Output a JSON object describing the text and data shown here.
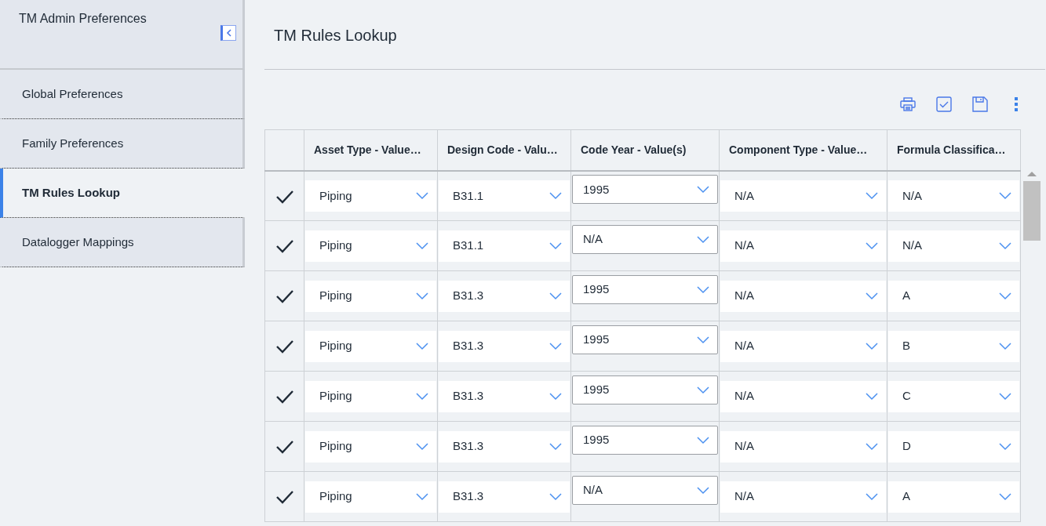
{
  "sidebar": {
    "title": "TM Admin Preferences",
    "items": [
      {
        "label": "Global Preferences",
        "selected": false
      },
      {
        "label": "Family Preferences",
        "selected": false
      },
      {
        "label": "TM Rules Lookup",
        "selected": true
      },
      {
        "label": "Datalogger Mappings",
        "selected": false
      }
    ]
  },
  "page_title": "TM Rules Lookup",
  "table": {
    "columns": [
      {
        "label": "Asset Type - Value…",
        "kind": "dropdown"
      },
      {
        "label": "Design Code - Valu…",
        "kind": "dropdown"
      },
      {
        "label": "Code Year - Value(s)",
        "kind": "combobox"
      },
      {
        "label": "Component Type - Value…",
        "kind": "dropdown"
      },
      {
        "label": "Formula Classifica…",
        "kind": "dropdown"
      }
    ],
    "rows": [
      {
        "checked": true,
        "cells": [
          "Piping",
          "B31.1",
          "1995",
          "N/A",
          "N/A"
        ]
      },
      {
        "checked": true,
        "cells": [
          "Piping",
          "B31.1",
          "N/A",
          "N/A",
          "N/A"
        ]
      },
      {
        "checked": true,
        "cells": [
          "Piping",
          "B31.3",
          "1995",
          "N/A",
          "A"
        ]
      },
      {
        "checked": true,
        "cells": [
          "Piping",
          "B31.3",
          "1995",
          "N/A",
          "B"
        ]
      },
      {
        "checked": true,
        "cells": [
          "Piping",
          "B31.3",
          "1995",
          "N/A",
          "C"
        ]
      },
      {
        "checked": true,
        "cells": [
          "Piping",
          "B31.3",
          "1995",
          "N/A",
          "D"
        ]
      },
      {
        "checked": true,
        "cells": [
          "Piping",
          "B31.3",
          "N/A",
          "N/A",
          "A"
        ]
      }
    ]
  }
}
